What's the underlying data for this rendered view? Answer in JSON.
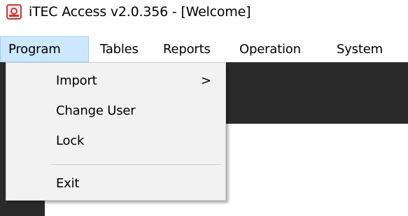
{
  "window": {
    "title": "iTEC Access v2.0.356 - [Welcome]",
    "icon": "app-logo-icon"
  },
  "menubar": {
    "items": [
      {
        "label": "Program"
      },
      {
        "label": "Tables"
      },
      {
        "label": "Reports"
      },
      {
        "label": "Operation"
      },
      {
        "label": "System"
      }
    ],
    "active": "Program"
  },
  "program_menu": {
    "items": [
      {
        "label": "Import",
        "submenu_arrow": ">"
      },
      {
        "label": "Change User"
      },
      {
        "label": "Lock"
      },
      {
        "label": "Exit"
      }
    ]
  },
  "colors": {
    "active_menu_bg": "#cce8ff",
    "active_menu_border": "#99d1ff",
    "dropdown_bg": "#f2f2f2",
    "workspace_dark": "#2a2a2a",
    "app_icon": "#c03a3a"
  }
}
